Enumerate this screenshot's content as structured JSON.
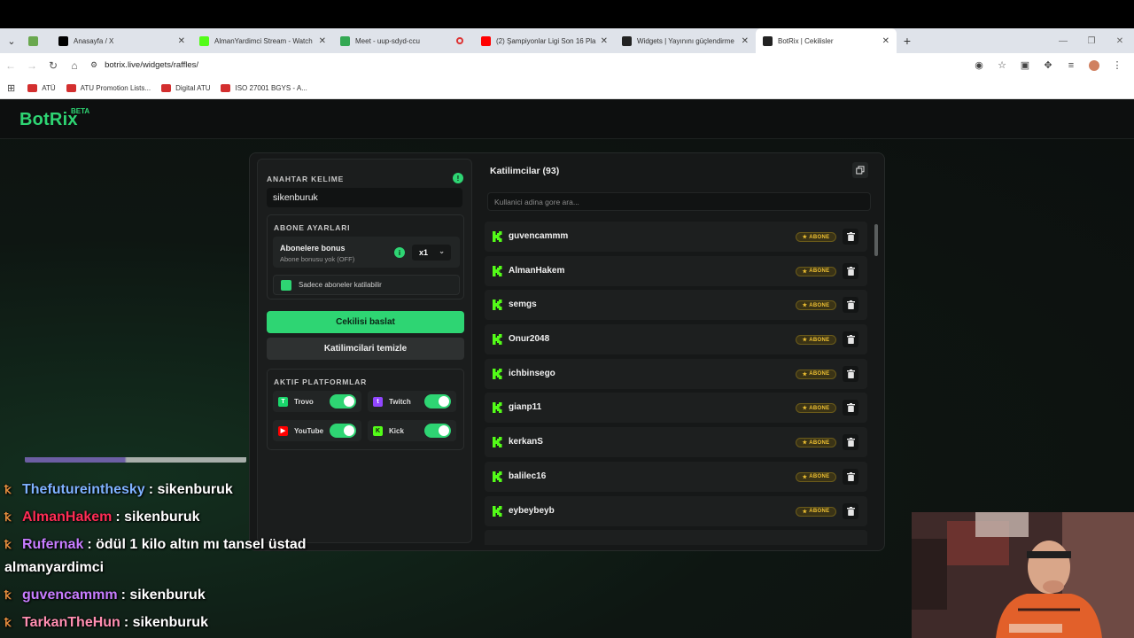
{
  "browser": {
    "tabs": [
      {
        "title": "",
        "favicon": "#6aa84f",
        "close": ""
      },
      {
        "title": "Anasayfa / X",
        "favicon": "#000000",
        "close": "✕"
      },
      {
        "title": "AlmanYardimci Stream - Watch",
        "favicon": "#53fc18",
        "close": "✕"
      },
      {
        "title": "Meet - uup-sdyd-ccu",
        "favicon": "#34a853",
        "close": ""
      },
      {
        "title": "(2) Şampiyonlar Ligi Son 16 Pla",
        "favicon": "#ff0000",
        "close": "✕"
      },
      {
        "title": "Widgets | Yayınını güçlendirme",
        "favicon": "#222222",
        "close": "✕"
      },
      {
        "title": "BotRix | Cekilisler",
        "favicon": "#222222",
        "close": "✕"
      }
    ],
    "new_tab": "+",
    "url": "botrix.live/widgets/raffles/",
    "bookmarks": [
      "ATÜ",
      "ATU Promotion Lists...",
      "Digital ATU",
      "ISO 27001 BGYS - A..."
    ]
  },
  "app": {
    "logo": "BotRix",
    "beta": "BETA"
  },
  "settings": {
    "keyword_label": "ANAHTAR KELIME",
    "keyword_value": "sikenburuk",
    "subscriber_title": "ABONE AYARLARI",
    "bonus_name": "Abonelere bonus",
    "bonus_desc": "Abone bonusu yok (OFF)",
    "multiplier": "x1",
    "only_subs": "Sadece aboneler katilabilir",
    "start_button": "Cekilisi baslat",
    "clear_button": "Katilimcilari temizle",
    "platforms_title": "AKTIF PLATFORMLAR",
    "platforms": [
      {
        "name": "Trovo",
        "color": "#19d66b",
        "enabled": true
      },
      {
        "name": "Twitch",
        "color": "#9146ff",
        "enabled": true
      },
      {
        "name": "YouTube",
        "color": "#ff0000",
        "enabled": true
      },
      {
        "name": "Kick",
        "color": "#53fc18",
        "enabled": true
      }
    ]
  },
  "participants": {
    "title": "Katilimcilar (93)",
    "search_placeholder": "Kullanici adina gore ara...",
    "badge_label": "ABONE",
    "users": [
      "guvencammm",
      "AlmanHakem",
      "semgs",
      "Onur2048",
      "ichbinsego",
      "gianp11",
      "kerkanS",
      "balilec16",
      "eybeybeyb"
    ]
  },
  "chat": {
    "messages": [
      {
        "user": "Thefutureinthesky",
        "color": "#7fb2ff",
        "text": ": sikenburuk"
      },
      {
        "user": "AlmanHakem",
        "color": "#ff2d55",
        "text": ": sikenburuk"
      },
      {
        "user": "Rufernak",
        "color": "#c77dff",
        "text": ": ödül 1 kilo altın mı tansel üstad"
      },
      {
        "user": "",
        "color": "#ffffff",
        "text": "almanyardimci"
      },
      {
        "user": "guvencammm",
        "color": "#c77dff",
        "text": ": sikenburuk"
      },
      {
        "user": "TarkanTheHun",
        "color": "#ff8fb1",
        "text": ": sikenburuk"
      }
    ]
  },
  "colors": {
    "accent": "#2ed573",
    "badge_gold": "#f1c232"
  }
}
